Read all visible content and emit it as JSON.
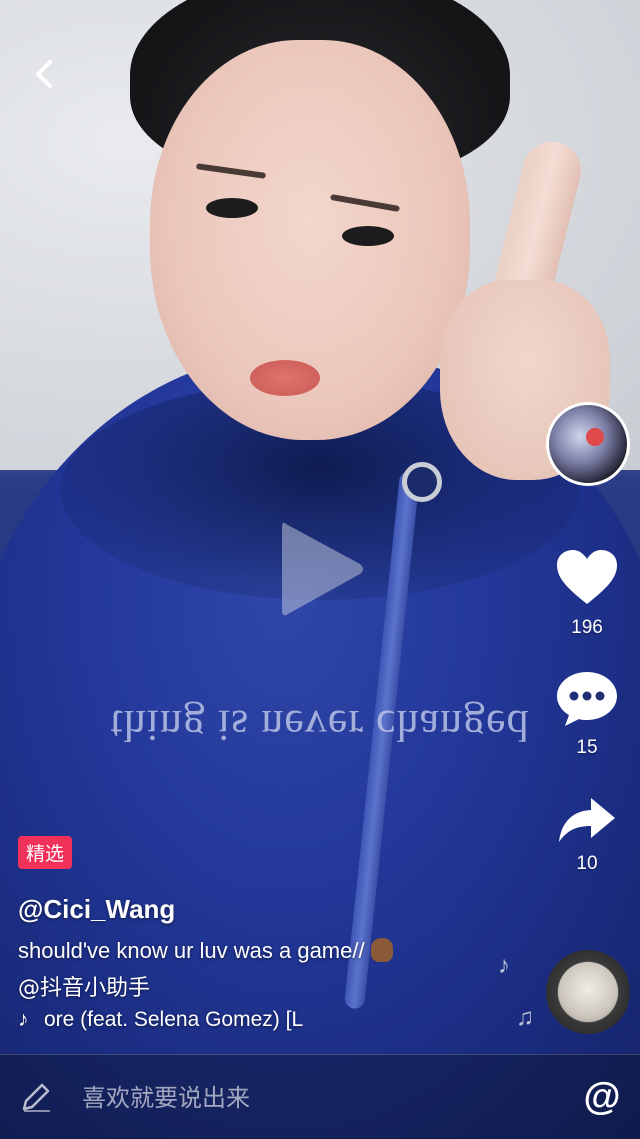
{
  "video": {
    "shirt_text": "thing is never changed"
  },
  "header": {
    "back_icon": "chevron-left-icon"
  },
  "player": {
    "play_icon": "play-icon"
  },
  "sidebar": {
    "avatar_icon": "user-avatar",
    "like_count": "196",
    "comment_count": "15",
    "share_count": "10"
  },
  "post": {
    "badge": "精选",
    "username": "@Cici_Wang",
    "caption": "should've know ur luv was a game//",
    "mention": "@抖音小助手",
    "music_title": "ore (feat. Selena Gomez) [L"
  },
  "comment_bar": {
    "placeholder": "喜欢就要说出来",
    "at_symbol": "@"
  },
  "colors": {
    "badge": "#f2315a",
    "text": "#ffffff"
  }
}
